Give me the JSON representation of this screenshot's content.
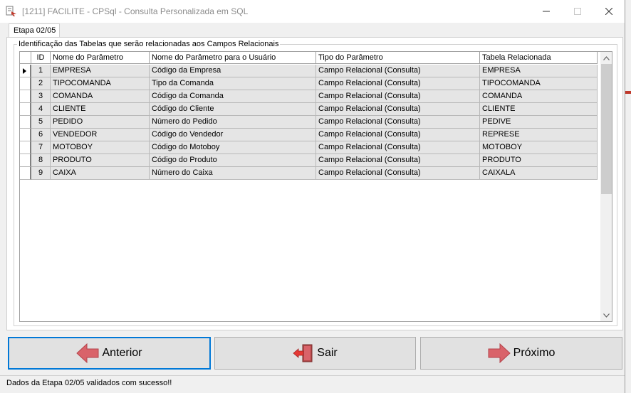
{
  "window": {
    "title": "[1211] FACILITE - CPSql - Consulta Personalizada em SQL"
  },
  "tab": {
    "label": "Etapa 02/05"
  },
  "group": {
    "legend": "Identificação das Tabelas que serão relacionadas aos Campos Relacionais"
  },
  "grid": {
    "columns": [
      "ID",
      "Nome do Parâmetro",
      "Nome do Parâmetro para o Usuário",
      "Tipo do Parâmetro",
      "Tabela Relacionada"
    ],
    "rows": [
      {
        "id": "1",
        "nome": "EMPRESA",
        "usuario": "Código da Empresa",
        "tipo": "Campo Relacional (Consulta)",
        "tabela": "EMPRESA"
      },
      {
        "id": "2",
        "nome": "TIPOCOMANDA",
        "usuario": "Tipo da Comanda",
        "tipo": "Campo Relacional (Consulta)",
        "tabela": "TIPOCOMANDA"
      },
      {
        "id": "3",
        "nome": "COMANDA",
        "usuario": "Código da Comanda",
        "tipo": "Campo Relacional (Consulta)",
        "tabela": "COMANDA"
      },
      {
        "id": "4",
        "nome": "CLIENTE",
        "usuario": "Código do Cliente",
        "tipo": "Campo Relacional (Consulta)",
        "tabela": "CLIENTE"
      },
      {
        "id": "5",
        "nome": "PEDIDO",
        "usuario": "Número do Pedido",
        "tipo": "Campo Relacional (Consulta)",
        "tabela": "PEDIVE"
      },
      {
        "id": "6",
        "nome": "VENDEDOR",
        "usuario": "Código do Vendedor",
        "tipo": "Campo Relacional (Consulta)",
        "tabela": "REPRESE"
      },
      {
        "id": "7",
        "nome": "MOTOBOY",
        "usuario": "Código do Motoboy",
        "tipo": "Campo Relacional (Consulta)",
        "tabela": "MOTOBOY"
      },
      {
        "id": "8",
        "nome": "PRODUTO",
        "usuario": "Código do Produto",
        "tipo": "Campo Relacional (Consulta)",
        "tabela": "PRODUTO"
      },
      {
        "id": "9",
        "nome": "CAIXA",
        "usuario": "Número do Caixa",
        "tipo": "Campo Relacional (Consulta)",
        "tabela": "CAIXALA"
      }
    ]
  },
  "buttons": {
    "anterior": "Anterior",
    "sair": "Sair",
    "proximo": "Próximo"
  },
  "status": {
    "text": "Dados da Etapa 02/05 validados com sucesso!!"
  },
  "icons": {
    "app": "app-logo-icon",
    "anterior": "arrow-left-icon",
    "sair": "exit-door-icon",
    "proximo": "arrow-right-icon"
  },
  "colors": {
    "arrow": "#d9636a",
    "focus": "#0078d7",
    "row": "#e5e5e5"
  }
}
